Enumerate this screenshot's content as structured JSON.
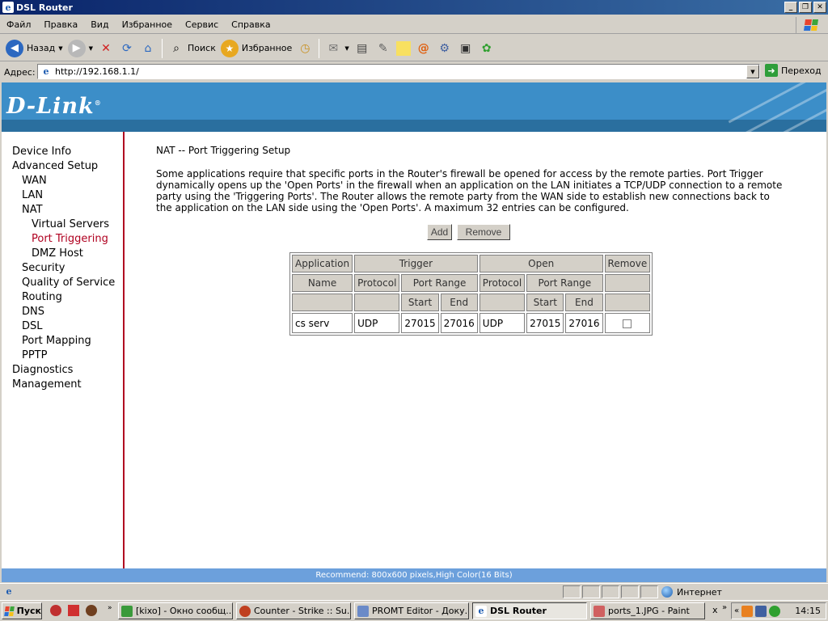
{
  "window": {
    "title": "DSL Router"
  },
  "menu": [
    "Файл",
    "Правка",
    "Вид",
    "Избранное",
    "Сервис",
    "Справка"
  ],
  "toolbar": {
    "back_label": "Назад",
    "search_label": "Поиск",
    "favorites_label": "Избранное"
  },
  "address": {
    "label": "Адрес:",
    "url": "http://192.168.1.1/",
    "go_label": "Переход"
  },
  "brand": {
    "logo": "D-Link"
  },
  "sidebar": {
    "items": [
      {
        "label": "Device Info"
      },
      {
        "label": "Advanced Setup"
      },
      {
        "label": "WAN"
      },
      {
        "label": "LAN"
      },
      {
        "label": "NAT"
      },
      {
        "label": "Virtual Servers"
      },
      {
        "label": "Port Triggering"
      },
      {
        "label": "DMZ Host"
      },
      {
        "label": "Security"
      },
      {
        "label": "Quality of Service"
      },
      {
        "label": "Routing"
      },
      {
        "label": "DNS"
      },
      {
        "label": "DSL"
      },
      {
        "label": "Port Mapping"
      },
      {
        "label": "PPTP"
      },
      {
        "label": "Diagnostics"
      },
      {
        "label": "Management"
      }
    ],
    "active": "Port Triggering"
  },
  "page": {
    "title": "NAT -- Port Triggering Setup",
    "description": "Some applications require that specific ports in the Router's firewall be opened for access by the remote parties. Port Trigger dynamically opens up the 'Open Ports' in the firewall when an application on the LAN initiates a TCP/UDP connection to a remote party using the 'Triggering Ports'. The Router allows the remote party from the WAN side to establish new connections back to the application on the LAN side using the 'Open Ports'. A maximum 32 entries can be configured.",
    "add_label": "Add",
    "remove_label": "Remove"
  },
  "table": {
    "h_application": "Application",
    "h_trigger": "Trigger",
    "h_open": "Open",
    "h_remove": "Remove",
    "h_name": "Name",
    "h_protocol": "Protocol",
    "h_port_range": "Port Range",
    "h_start": "Start",
    "h_end": "End",
    "rows": [
      {
        "name": "cs serv",
        "trigger_protocol": "UDP",
        "trigger_start": "27015",
        "trigger_end": "27016",
        "open_protocol": "UDP",
        "open_start": "27015",
        "open_end": "27016"
      }
    ]
  },
  "footer": {
    "text": "Recommend: 800x600 pixels,High Color(16 Bits)"
  },
  "status": {
    "zone": "Интернет"
  },
  "taskbar": {
    "start_label": "Пуск",
    "tasks": [
      {
        "label": "[kixo] - Окно сообщ..."
      },
      {
        "label": "Counter - Strike :: Su..."
      },
      {
        "label": "PROMT Editor - Доку..."
      },
      {
        "label": "DSL Router"
      },
      {
        "label": "ports_1.JPG - Paint"
      }
    ],
    "clock": "14:15"
  },
  "colors": {
    "banner": "#3c8ec8",
    "active_nav": "#b00020",
    "footer": "#6ca0dc"
  }
}
